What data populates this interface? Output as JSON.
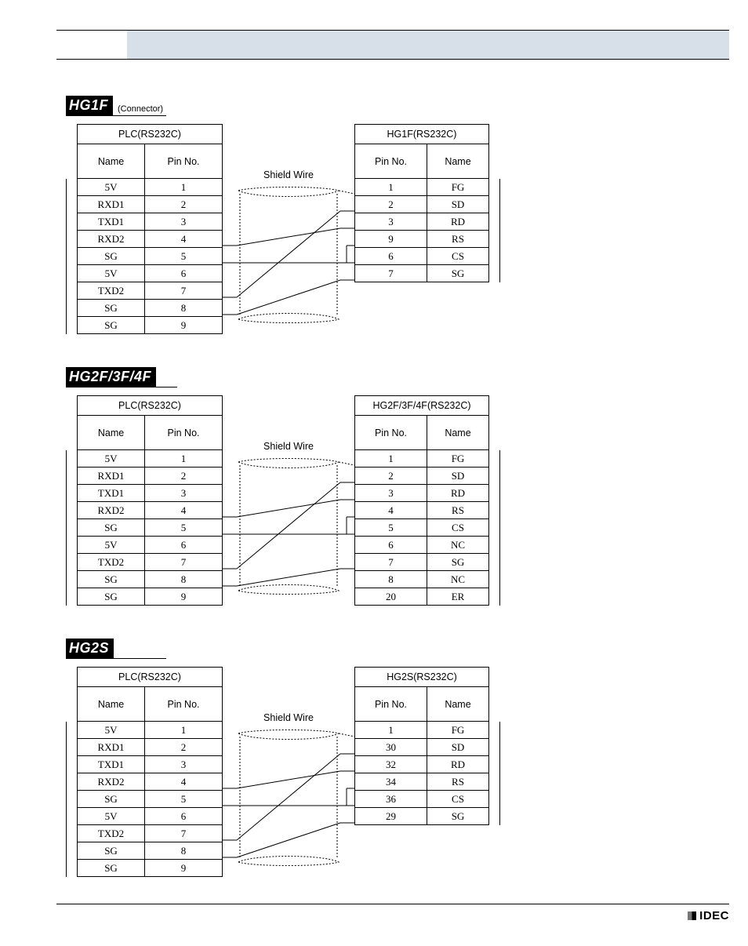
{
  "brand": "IDEC",
  "sections": [
    {
      "id": "hg1f",
      "model": "HG1F",
      "connector_note": "(Connector)",
      "left_device": "PLC(RS232C)",
      "right_device": "HG1F(RS232C)",
      "shield_label": "Shield Wire",
      "left_cols": {
        "name": "Name",
        "pin": "Pin No."
      },
      "right_cols": {
        "pin": "Pin No.",
        "name": "Name"
      },
      "left_rows": [
        {
          "name": "5V",
          "pin": "1"
        },
        {
          "name": "RXD1",
          "pin": "2"
        },
        {
          "name": "TXD1",
          "pin": "3"
        },
        {
          "name": "RXD2",
          "pin": "4"
        },
        {
          "name": "SG",
          "pin": "5"
        },
        {
          "name": "5V",
          "pin": "6"
        },
        {
          "name": "TXD2",
          "pin": "7"
        },
        {
          "name": "SG",
          "pin": "8"
        },
        {
          "name": "SG",
          "pin": "9"
        }
      ],
      "right_rows": [
        {
          "pin": "1",
          "name": "FG"
        },
        {
          "pin": "2",
          "name": "SD"
        },
        {
          "pin": "3",
          "name": "RD"
        },
        {
          "pin": "9",
          "name": "RS"
        },
        {
          "pin": "6",
          "name": "CS"
        },
        {
          "pin": "7",
          "name": "SG"
        }
      ]
    },
    {
      "id": "hg234f",
      "model": "HG2F/3F/4F",
      "connector_note": "",
      "left_device": "PLC(RS232C)",
      "right_device": "HG2F/3F/4F(RS232C)",
      "shield_label": "Shield Wire",
      "left_cols": {
        "name": "Name",
        "pin": "Pin No."
      },
      "right_cols": {
        "pin": "Pin No.",
        "name": "Name"
      },
      "left_rows": [
        {
          "name": "5V",
          "pin": "1"
        },
        {
          "name": "RXD1",
          "pin": "2"
        },
        {
          "name": "TXD1",
          "pin": "3"
        },
        {
          "name": "RXD2",
          "pin": "4"
        },
        {
          "name": "SG",
          "pin": "5"
        },
        {
          "name": "5V",
          "pin": "6"
        },
        {
          "name": "TXD2",
          "pin": "7"
        },
        {
          "name": "SG",
          "pin": "8"
        },
        {
          "name": "SG",
          "pin": "9"
        }
      ],
      "right_rows": [
        {
          "pin": "1",
          "name": "FG"
        },
        {
          "pin": "2",
          "name": "SD"
        },
        {
          "pin": "3",
          "name": "RD"
        },
        {
          "pin": "4",
          "name": "RS"
        },
        {
          "pin": "5",
          "name": "CS"
        },
        {
          "pin": "6",
          "name": "NC"
        },
        {
          "pin": "7",
          "name": "SG"
        },
        {
          "pin": "8",
          "name": "NC"
        },
        {
          "pin": "20",
          "name": "ER"
        }
      ]
    },
    {
      "id": "hg2s",
      "model": "HG2S",
      "connector_note": "",
      "left_device": "PLC(RS232C)",
      "right_device": "HG2S(RS232C)",
      "shield_label": "Shield Wire",
      "left_cols": {
        "name": "Name",
        "pin": "Pin No."
      },
      "right_cols": {
        "pin": "Pin No.",
        "name": "Name"
      },
      "left_rows": [
        {
          "name": "5V",
          "pin": "1"
        },
        {
          "name": "RXD1",
          "pin": "2"
        },
        {
          "name": "TXD1",
          "pin": "3"
        },
        {
          "name": "RXD2",
          "pin": "4"
        },
        {
          "name": "SG",
          "pin": "5"
        },
        {
          "name": "5V",
          "pin": "6"
        },
        {
          "name": "TXD2",
          "pin": "7"
        },
        {
          "name": "SG",
          "pin": "8"
        },
        {
          "name": "SG",
          "pin": "9"
        }
      ],
      "right_rows": [
        {
          "pin": "1",
          "name": "FG"
        },
        {
          "pin": "30",
          "name": "SD"
        },
        {
          "pin": "32",
          "name": "RD"
        },
        {
          "pin": "34",
          "name": "RS"
        },
        {
          "pin": "36",
          "name": "CS"
        },
        {
          "pin": "29",
          "name": "SG"
        }
      ]
    }
  ]
}
